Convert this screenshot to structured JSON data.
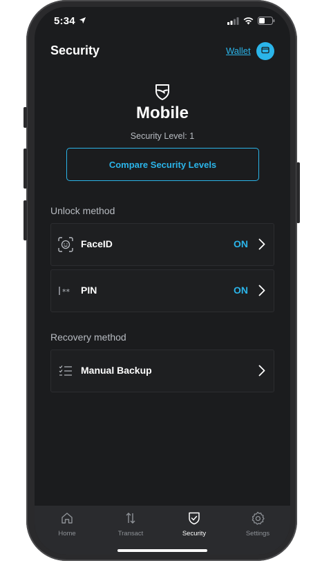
{
  "status_bar": {
    "time": "5:34"
  },
  "header": {
    "title": "Security",
    "wallet_link": "Wallet"
  },
  "device": {
    "name": "Mobile",
    "security_level": "Security Level: 1"
  },
  "compare_button": "Compare Security Levels",
  "unlock_section": {
    "label": "Unlock method",
    "items": [
      {
        "label": "FaceID",
        "status": "ON",
        "icon": "faceid-icon"
      },
      {
        "label": "PIN",
        "status": "ON",
        "icon": "pin-icon"
      }
    ]
  },
  "recovery_section": {
    "label": "Recovery method",
    "items": [
      {
        "label": "Manual Backup",
        "icon": "checklist-icon"
      }
    ]
  },
  "tabs": [
    {
      "label": "Home",
      "icon": "home-icon",
      "active": false
    },
    {
      "label": "Transact",
      "icon": "transfer-arrows-icon",
      "active": false
    },
    {
      "label": "Security",
      "icon": "shield-check-icon",
      "active": true
    },
    {
      "label": "Settings",
      "icon": "gear-icon",
      "active": false
    }
  ],
  "colors": {
    "accent": "#2bb5ea",
    "background": "#1b1c1e",
    "card": "#1e1f21",
    "tabbar": "#2a2b2e"
  }
}
